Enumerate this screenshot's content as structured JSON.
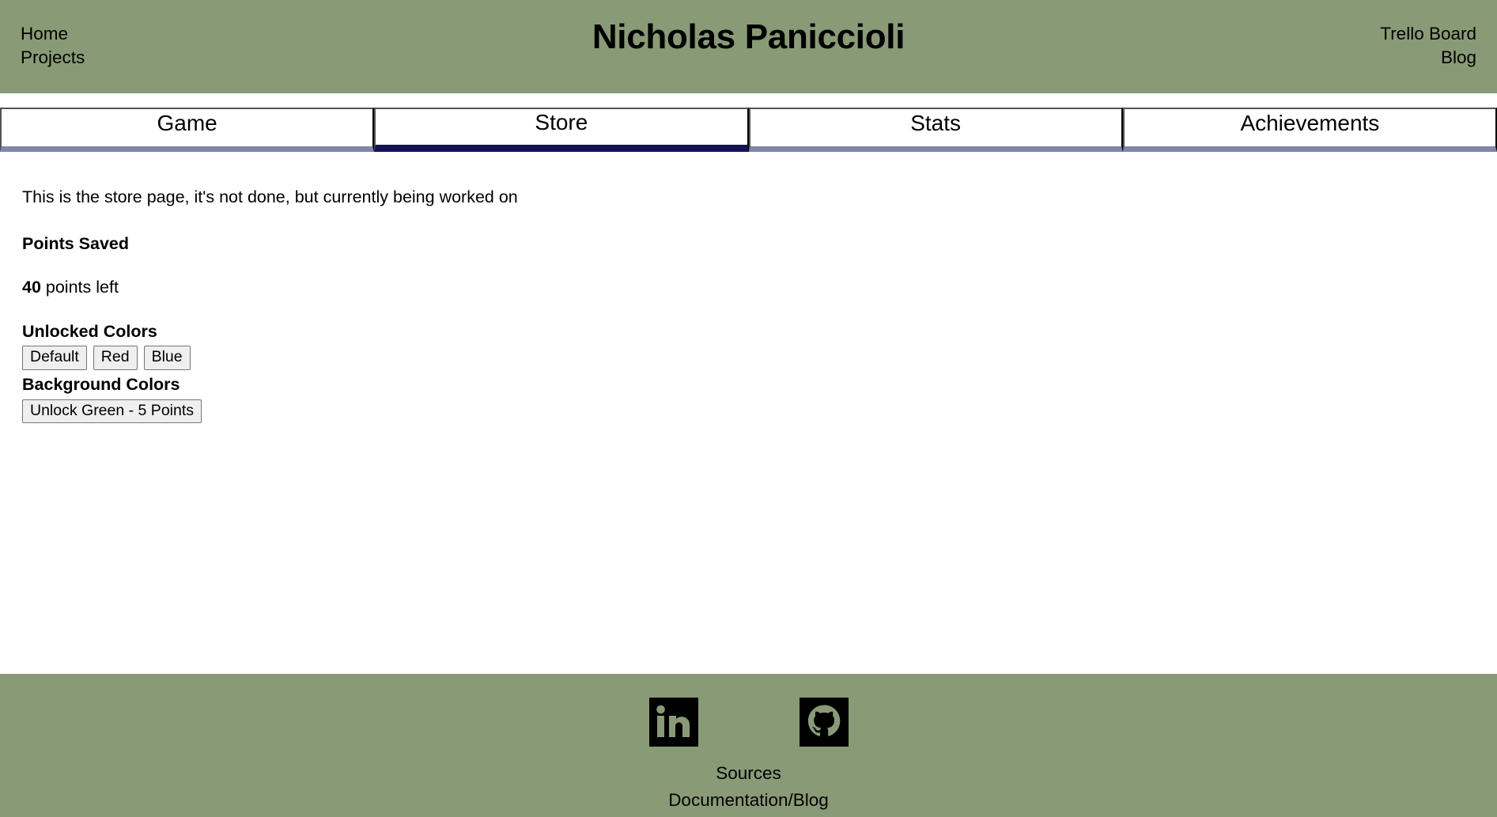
{
  "header": {
    "title": "Nicholas Paniccioli",
    "left_links": [
      {
        "label": "Home"
      },
      {
        "label": "Projects"
      }
    ],
    "right_links": [
      {
        "label": "Trello Board"
      },
      {
        "label": "Blog"
      }
    ],
    "background_color": "#899a77"
  },
  "tabs": {
    "active_index": 1,
    "active_underline_color": "#131356",
    "inactive_underline_color": "#8085ac",
    "items": [
      {
        "label": "Game"
      },
      {
        "label": "Store"
      },
      {
        "label": "Stats"
      },
      {
        "label": "Achievements"
      }
    ]
  },
  "main": {
    "intro": "This is the store page, it's not done, but currently being worked on",
    "points_saved_heading": "Points Saved",
    "points_value": "40",
    "points_suffix": " points left",
    "unlocked_colors_heading": "Unlocked Colors",
    "unlocked_color_buttons": [
      {
        "label": "Default"
      },
      {
        "label": "Red"
      },
      {
        "label": "Blue"
      }
    ],
    "background_colors_heading": "Background Colors",
    "background_color_buttons": [
      {
        "label": "Unlock Green - 5 Points"
      }
    ]
  },
  "footer": {
    "background_color": "#899a77",
    "icons": [
      {
        "name": "linkedin-icon"
      },
      {
        "name": "github-icon"
      }
    ],
    "sources_label": "Sources",
    "documentation_label": "Documentation/Blog"
  }
}
